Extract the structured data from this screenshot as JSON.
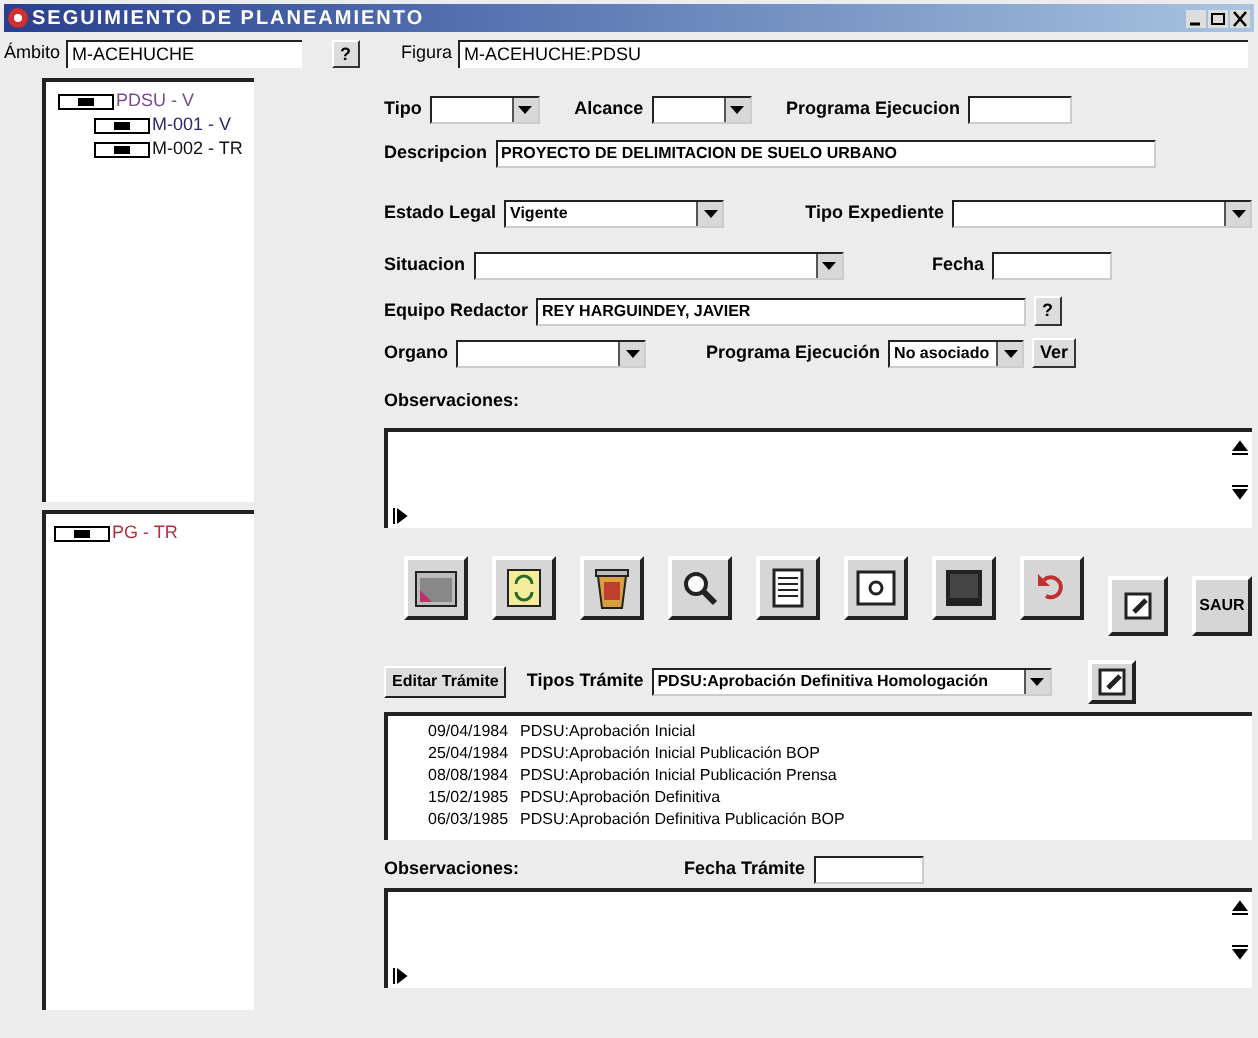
{
  "window": {
    "title": "SEGUIMIENTO DE PLANEAMIENTO"
  },
  "ambito": {
    "label": "Ámbito",
    "value": "M-ACEHUCHE",
    "button": "?"
  },
  "figura": {
    "label": "Figura",
    "value": "M-ACEHUCHE:PDSU"
  },
  "tree_top": [
    {
      "label": "PDSU - V",
      "color": "#7a4a8c",
      "children": [
        {
          "label": "M-001 - V",
          "color": "#2a2a6a"
        },
        {
          "label": "M-002 - TR",
          "color": "#111111"
        }
      ]
    }
  ],
  "tree_bottom": [
    {
      "label": "PG - TR",
      "color": "#b03040"
    }
  ],
  "form_rows": [
    [
      {
        "kind": "select",
        "label": "Tipo"
      },
      {
        "kind": "select",
        "label": "Alcance"
      },
      {
        "kind": "text",
        "label": "Programa Ejecucion"
      }
    ],
    [
      {
        "kind": "text",
        "label": "Descripcion",
        "value": "PROYECTO DE DELIMITACION DE SUELO URBANO"
      }
    ],
    [
      {
        "kind": "select",
        "label": "Estado Legal",
        "value": "Vigente"
      },
      {
        "kind": "select",
        "label": "Tipo Expediente"
      }
    ],
    [
      {
        "kind": "select",
        "label": "Situacion"
      },
      {
        "kind": "text",
        "label": "Fecha"
      }
    ],
    [
      {
        "kind": "lookup",
        "label": "Equipo Redactor",
        "value": "REY HARGUINDEY, JAVIER",
        "button": "?"
      }
    ],
    [
      {
        "kind": "select",
        "label": "Organo"
      },
      {
        "kind": "select",
        "label": "Programa Ejecución",
        "value": "No asociado",
        "button": "Ver"
      }
    ]
  ],
  "observaciones_label": "Observaciones:",
  "toolbar": [
    {
      "kind": "map"
    },
    {
      "kind": "refresh"
    },
    {
      "kind": "trash"
    },
    {
      "kind": "search"
    },
    {
      "kind": "document"
    },
    {
      "kind": "photo"
    },
    {
      "kind": "monitor"
    },
    {
      "kind": "undo"
    },
    {
      "kind": "edit"
    },
    {
      "kind": "text",
      "label": "SAUR"
    }
  ],
  "tramite": {
    "edit_button": "Editar Trámite",
    "tipos_label": "Tipos Trámite",
    "tipos_value": "PDSU:Aprobación Definitiva Homologación"
  },
  "tramites": [
    {
      "date": "09/04/1984",
      "name": "PDSU:Aprobación Inicial"
    },
    {
      "date": "25/04/1984",
      "name": "PDSU:Aprobación Inicial Publicación BOP"
    },
    {
      "date": "08/08/1984",
      "name": "PDSU:Aprobación Inicial Publicación Prensa"
    },
    {
      "date": "15/02/1985",
      "name": "PDSU:Aprobación Definitiva"
    },
    {
      "date": "06/03/1985",
      "name": "PDSU:Aprobación Definitiva Publicación BOP"
    }
  ],
  "bottom": {
    "observaciones_label": "Observaciones:",
    "fecha_label": "Fecha Trámite"
  }
}
